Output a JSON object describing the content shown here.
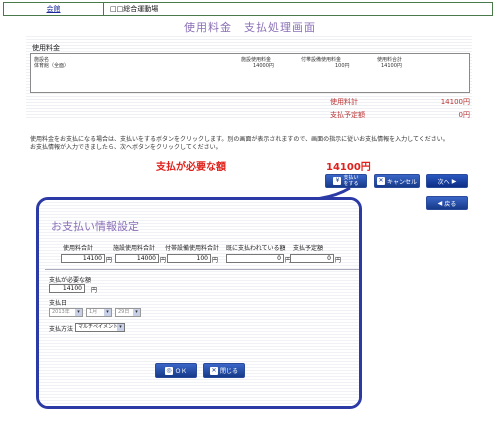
{
  "nav": {
    "home_label": "会館",
    "facility_name": "□□総合運動場"
  },
  "screen_title": "使用料金　支払処理画面",
  "fee_section": {
    "label": "使用料金",
    "headers": {
      "facility": "施設名",
      "facility_fee": "施設使用料金",
      "equipment_fee": "付帯設備使用料金",
      "total": "使用料合計"
    },
    "row": {
      "facility": "体育館（全面）",
      "facility_fee": "14000円",
      "equipment_fee": "100円",
      "total": "14100円"
    }
  },
  "summary": {
    "total_label": "使用料計",
    "total_value": "14100円",
    "planned_label": "支払予定額",
    "planned_value": "0円"
  },
  "instructions": [
    "使用料金をお支払になる場合は、支払いをするボタンをクリックします。別の画面が表示されますので、画面の指示に従いお支払情報を入力してください。",
    "お支払情報が入力できましたら、次へボタンをクリックしてください。"
  ],
  "need": {
    "label": "支払が必要な額",
    "amount": "14100円"
  },
  "buttons": {
    "pay": "支払い\nをする",
    "cancel": "キャンセル",
    "next": "次へ",
    "back": "戻る"
  },
  "dialog": {
    "title": "お支払い情報設定",
    "columns": {
      "total": "使用料合計",
      "facility": "施設使用料合計",
      "equipment": "付帯設備使用料合計",
      "paid": "既に支払われている額",
      "planned": "支払予定額"
    },
    "values": {
      "total": "14100",
      "facility": "14000",
      "equipment": "100",
      "paid": "0",
      "planned": "0"
    },
    "yen": "円",
    "need_label": "支払が必要な額",
    "need_value": "14100",
    "date_label": "支払日",
    "date_year": "2013年",
    "date_month": "1月",
    "date_day": "29日",
    "method_label": "支払方法",
    "method_value": "マルチペイメント",
    "ok_label": "ＯＫ",
    "close_label": "閉じる"
  },
  "colors": {
    "accent": "#2c3aa6",
    "title": "#8a6fb6",
    "alert": "#e0201a",
    "summary": "#b33333"
  }
}
